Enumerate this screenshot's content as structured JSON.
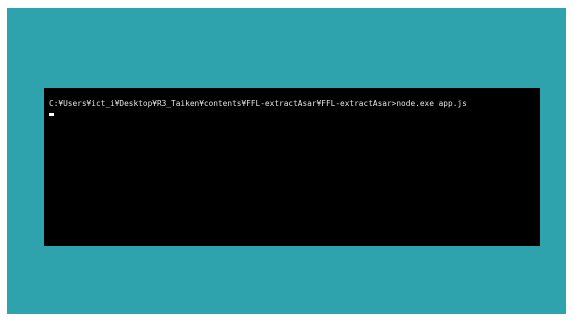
{
  "screen": {
    "background_color": "#2ea2ad",
    "terminal_background": "#000000",
    "terminal_text_color": "#e6e6e6"
  },
  "terminal": {
    "command_line": "C:¥Users¥ict_i¥Desktop¥R3_Taiken¥contents¥FFL-extractAsar¥FFL-extractAsar>node.exe app.js"
  }
}
